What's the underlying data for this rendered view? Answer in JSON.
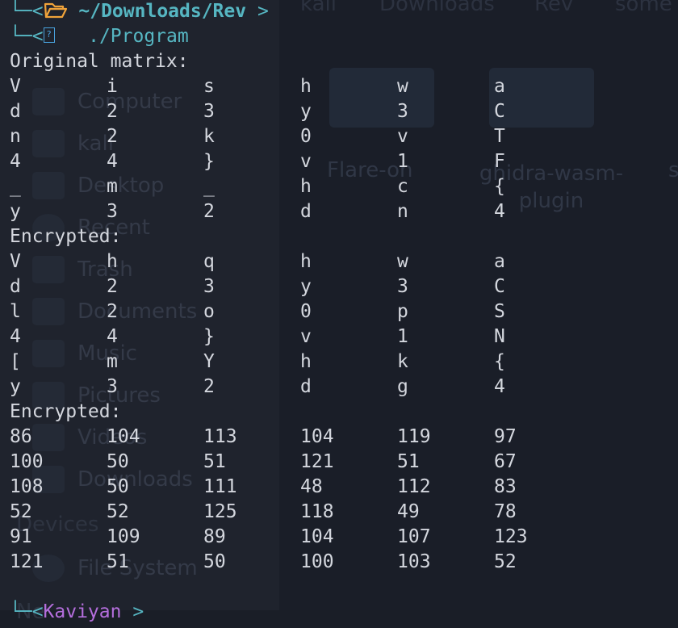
{
  "background_window": {
    "breadcrumbs": [
      "kali",
      "Downloads",
      "Rev",
      "some"
    ],
    "sidebar_items": [
      {
        "label": "Computer",
        "icon": "computer-icon"
      },
      {
        "label": "kali",
        "icon": "home-folder-icon"
      },
      {
        "label": "Desktop",
        "icon": "desktop-icon"
      },
      {
        "label": "Recent",
        "icon": "clock-icon"
      },
      {
        "label": "Trash",
        "icon": "trash-icon"
      },
      {
        "label": "Documents",
        "icon": "documents-icon"
      },
      {
        "label": "Music",
        "icon": "music-icon"
      },
      {
        "label": "Pictures",
        "icon": "pictures-icon"
      },
      {
        "label": "Videos",
        "icon": "videos-icon"
      },
      {
        "label": "Downloads",
        "icon": "downloads-icon"
      }
    ],
    "devices_header": "Devices",
    "device_items": [
      {
        "label": "File System",
        "icon": "disk-icon"
      }
    ],
    "network_header": "Ne",
    "folders": [
      {
        "label": "Flare-on"
      },
      {
        "label": "ghidra-wasm-plugin"
      },
      {
        "label": "s"
      }
    ]
  },
  "terminal": {
    "prompt1": {
      "tree": "└─<",
      "folder_icon": "folder-open-icon",
      "path": " ~/Downloads/Rev",
      "chevron": ">"
    },
    "prompt2": {
      "tree": "└─<",
      "file_icon": "unknown-glyph-icon",
      "command": "./Program"
    },
    "section1_title": "Original matrix:",
    "matrix_original": [
      [
        "V",
        "i",
        "s",
        "h",
        "w",
        "a"
      ],
      [
        "d",
        "2",
        "3",
        "y",
        "3",
        "C"
      ],
      [
        "n",
        "2",
        "k",
        "0",
        "v",
        "T"
      ],
      [
        "4",
        "4",
        "}",
        "v",
        "1",
        "F"
      ],
      [
        "_",
        "m",
        "_",
        "h",
        "c",
        "{"
      ],
      [
        "y",
        "3",
        "2",
        "d",
        "n",
        "4"
      ]
    ],
    "section2_title": "Encrypted:",
    "matrix_encrypted_chars": [
      [
        "V",
        "h",
        "q",
        "h",
        "w",
        "a"
      ],
      [
        "d",
        "2",
        "3",
        "y",
        "3",
        "C"
      ],
      [
        "l",
        "2",
        "o",
        "0",
        "p",
        "S"
      ],
      [
        "4",
        "4",
        "}",
        "v",
        "1",
        "N"
      ],
      [
        "[",
        "m",
        "Y",
        "h",
        "k",
        "{"
      ],
      [
        "y",
        "3",
        "2",
        "d",
        "g",
        "4"
      ]
    ],
    "section3_title": "Encrypted:",
    "matrix_encrypted_codes": [
      [
        "86",
        "104",
        "113",
        "104",
        "119",
        "97"
      ],
      [
        "100",
        "50",
        "51",
        "121",
        "51",
        "67"
      ],
      [
        "108",
        "50",
        "111",
        "48",
        "112",
        "83"
      ],
      [
        "52",
        "52",
        "125",
        "118",
        "49",
        "78"
      ],
      [
        "91",
        "109",
        "89",
        "104",
        "107",
        "123"
      ],
      [
        "121",
        "51",
        "50",
        "100",
        "103",
        "52"
      ]
    ],
    "next_prompt": {
      "tree": "└─<",
      "user": "Kaviyan",
      "chevron": ">"
    }
  }
}
